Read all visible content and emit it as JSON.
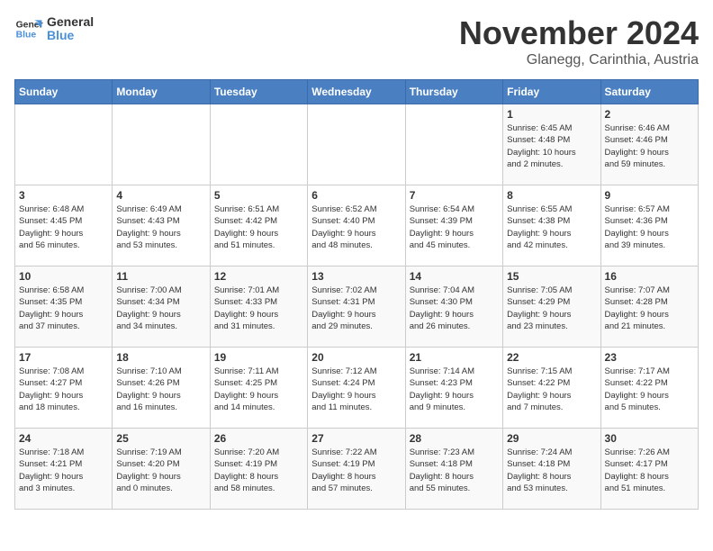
{
  "logo": {
    "line1": "General",
    "line2": "Blue"
  },
  "header": {
    "month": "November 2024",
    "location": "Glanegg, Carinthia, Austria"
  },
  "weekdays": [
    "Sunday",
    "Monday",
    "Tuesday",
    "Wednesday",
    "Thursday",
    "Friday",
    "Saturday"
  ],
  "weeks": [
    [
      {
        "day": "",
        "info": ""
      },
      {
        "day": "",
        "info": ""
      },
      {
        "day": "",
        "info": ""
      },
      {
        "day": "",
        "info": ""
      },
      {
        "day": "",
        "info": ""
      },
      {
        "day": "1",
        "info": "Sunrise: 6:45 AM\nSunset: 4:48 PM\nDaylight: 10 hours\nand 2 minutes."
      },
      {
        "day": "2",
        "info": "Sunrise: 6:46 AM\nSunset: 4:46 PM\nDaylight: 9 hours\nand 59 minutes."
      }
    ],
    [
      {
        "day": "3",
        "info": "Sunrise: 6:48 AM\nSunset: 4:45 PM\nDaylight: 9 hours\nand 56 minutes."
      },
      {
        "day": "4",
        "info": "Sunrise: 6:49 AM\nSunset: 4:43 PM\nDaylight: 9 hours\nand 53 minutes."
      },
      {
        "day": "5",
        "info": "Sunrise: 6:51 AM\nSunset: 4:42 PM\nDaylight: 9 hours\nand 51 minutes."
      },
      {
        "day": "6",
        "info": "Sunrise: 6:52 AM\nSunset: 4:40 PM\nDaylight: 9 hours\nand 48 minutes."
      },
      {
        "day": "7",
        "info": "Sunrise: 6:54 AM\nSunset: 4:39 PM\nDaylight: 9 hours\nand 45 minutes."
      },
      {
        "day": "8",
        "info": "Sunrise: 6:55 AM\nSunset: 4:38 PM\nDaylight: 9 hours\nand 42 minutes."
      },
      {
        "day": "9",
        "info": "Sunrise: 6:57 AM\nSunset: 4:36 PM\nDaylight: 9 hours\nand 39 minutes."
      }
    ],
    [
      {
        "day": "10",
        "info": "Sunrise: 6:58 AM\nSunset: 4:35 PM\nDaylight: 9 hours\nand 37 minutes."
      },
      {
        "day": "11",
        "info": "Sunrise: 7:00 AM\nSunset: 4:34 PM\nDaylight: 9 hours\nand 34 minutes."
      },
      {
        "day": "12",
        "info": "Sunrise: 7:01 AM\nSunset: 4:33 PM\nDaylight: 9 hours\nand 31 minutes."
      },
      {
        "day": "13",
        "info": "Sunrise: 7:02 AM\nSunset: 4:31 PM\nDaylight: 9 hours\nand 29 minutes."
      },
      {
        "day": "14",
        "info": "Sunrise: 7:04 AM\nSunset: 4:30 PM\nDaylight: 9 hours\nand 26 minutes."
      },
      {
        "day": "15",
        "info": "Sunrise: 7:05 AM\nSunset: 4:29 PM\nDaylight: 9 hours\nand 23 minutes."
      },
      {
        "day": "16",
        "info": "Sunrise: 7:07 AM\nSunset: 4:28 PM\nDaylight: 9 hours\nand 21 minutes."
      }
    ],
    [
      {
        "day": "17",
        "info": "Sunrise: 7:08 AM\nSunset: 4:27 PM\nDaylight: 9 hours\nand 18 minutes."
      },
      {
        "day": "18",
        "info": "Sunrise: 7:10 AM\nSunset: 4:26 PM\nDaylight: 9 hours\nand 16 minutes."
      },
      {
        "day": "19",
        "info": "Sunrise: 7:11 AM\nSunset: 4:25 PM\nDaylight: 9 hours\nand 14 minutes."
      },
      {
        "day": "20",
        "info": "Sunrise: 7:12 AM\nSunset: 4:24 PM\nDaylight: 9 hours\nand 11 minutes."
      },
      {
        "day": "21",
        "info": "Sunrise: 7:14 AM\nSunset: 4:23 PM\nDaylight: 9 hours\nand 9 minutes."
      },
      {
        "day": "22",
        "info": "Sunrise: 7:15 AM\nSunset: 4:22 PM\nDaylight: 9 hours\nand 7 minutes."
      },
      {
        "day": "23",
        "info": "Sunrise: 7:17 AM\nSunset: 4:22 PM\nDaylight: 9 hours\nand 5 minutes."
      }
    ],
    [
      {
        "day": "24",
        "info": "Sunrise: 7:18 AM\nSunset: 4:21 PM\nDaylight: 9 hours\nand 3 minutes."
      },
      {
        "day": "25",
        "info": "Sunrise: 7:19 AM\nSunset: 4:20 PM\nDaylight: 9 hours\nand 0 minutes."
      },
      {
        "day": "26",
        "info": "Sunrise: 7:20 AM\nSunset: 4:19 PM\nDaylight: 8 hours\nand 58 minutes."
      },
      {
        "day": "27",
        "info": "Sunrise: 7:22 AM\nSunset: 4:19 PM\nDaylight: 8 hours\nand 57 minutes."
      },
      {
        "day": "28",
        "info": "Sunrise: 7:23 AM\nSunset: 4:18 PM\nDaylight: 8 hours\nand 55 minutes."
      },
      {
        "day": "29",
        "info": "Sunrise: 7:24 AM\nSunset: 4:18 PM\nDaylight: 8 hours\nand 53 minutes."
      },
      {
        "day": "30",
        "info": "Sunrise: 7:26 AM\nSunset: 4:17 PM\nDaylight: 8 hours\nand 51 minutes."
      }
    ]
  ]
}
